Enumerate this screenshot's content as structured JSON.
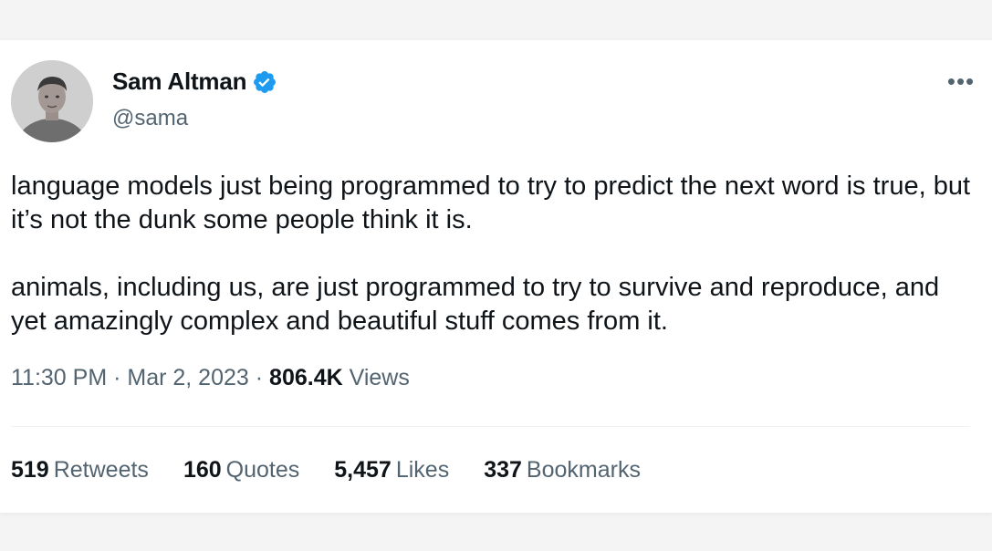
{
  "author": {
    "display_name": "Sam Altman",
    "handle": "@sama",
    "verified": true,
    "avatar_icon": "profile-photo",
    "verified_icon": "verified-badge-icon"
  },
  "more_icon_glyph": "•••",
  "tweet": {
    "paragraphs": [
      "language models just being programmed to try to predict the next word is true, but it’s not the dunk some people think it is.",
      "animals, including us, are just programmed to try to survive and reproduce, and yet amazingly complex and beautiful stuff comes from it."
    ]
  },
  "meta": {
    "time": "11:30 PM",
    "separator": "·",
    "date": "Mar 2, 2023",
    "views_count": "806.4K",
    "views_label": "Views"
  },
  "stats": [
    {
      "count": "519",
      "label": "Retweets"
    },
    {
      "count": "160",
      "label": "Quotes"
    },
    {
      "count": "5,457",
      "label": "Likes"
    },
    {
      "count": "337",
      "label": "Bookmarks"
    }
  ],
  "colors": {
    "verified_blue": "#1d9bf0",
    "text_primary": "#0f1419",
    "text_secondary": "#536471",
    "divider": "#eff3f4"
  }
}
